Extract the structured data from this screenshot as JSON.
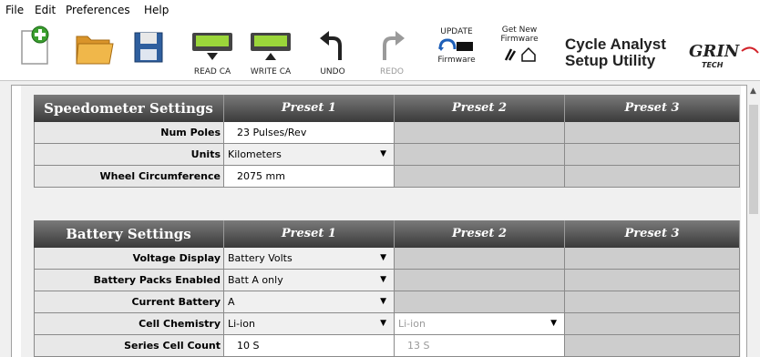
{
  "menu": {
    "file": "File",
    "edit": "Edit",
    "preferences": "Preferences",
    "help": "Help"
  },
  "toolbar": {
    "read_label": "READ CA",
    "write_label": "WRITE CA",
    "undo_label": "UNDO",
    "redo_label": "REDO",
    "update_top": "UPDATE",
    "update_bottom": "Firmware",
    "getnew_line1": "Get New",
    "getnew_line2": "Firmware"
  },
  "brand": {
    "line1": "Cycle Analyst",
    "line2": "Setup Utility",
    "logo_text": "GRIN",
    "logo_sub": "TECH"
  },
  "speedometer": {
    "title": "Speedometer Settings",
    "presets": [
      "Preset 1",
      "Preset 2",
      "Preset 3"
    ],
    "rows": [
      {
        "label": "Num Poles",
        "p1": "23 Pulses/Rev"
      },
      {
        "label": "Units",
        "p1": "Kilometers"
      },
      {
        "label": "Wheel Circumference",
        "p1": "2075 mm"
      }
    ]
  },
  "battery": {
    "title": "Battery Settings",
    "presets": [
      "Preset 1",
      "Preset 2",
      "Preset 3"
    ],
    "rows": [
      {
        "label": "Voltage Display",
        "p1": "Battery Volts"
      },
      {
        "label": "Battery Packs Enabled",
        "p1": "Batt A only"
      },
      {
        "label": "Current Battery",
        "p1": "A"
      },
      {
        "label": "Cell Chemistry",
        "p1": "Li-ion",
        "p2": "Li-ion"
      },
      {
        "label": "Series Cell Count",
        "p1": "10 S",
        "p2": "13 S"
      }
    ]
  },
  "colors": {
    "header_dark": "#3a3a3a",
    "disabled_cell": "#cdcdcd",
    "accent_green": "#2e9a2e"
  }
}
